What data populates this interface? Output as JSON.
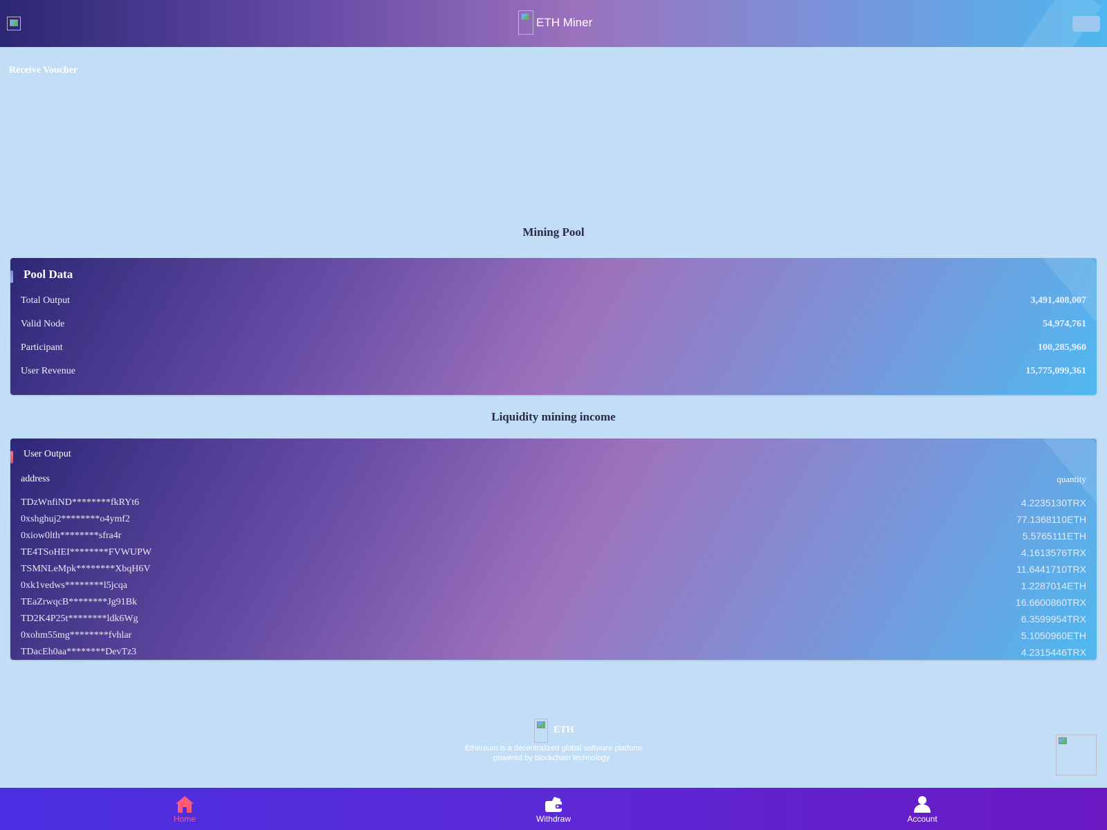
{
  "header": {
    "title": "ETH Miner"
  },
  "voucher_label": "Receive Voucher",
  "pool": {
    "section_title": "Mining Pool",
    "card_title": "Pool Data",
    "stats": [
      {
        "label": "Total Output",
        "value": "3,491,408,007"
      },
      {
        "label": "Valid Node",
        "value": "54,974,761"
      },
      {
        "label": "Participant",
        "value": "100,285,960"
      },
      {
        "label": "User Revenue",
        "value": "15,775,099,361"
      }
    ]
  },
  "liquidity": {
    "section_title": "Liquidity mining income",
    "card_title": "User Output",
    "col_address": "address",
    "col_quantity": "quantity",
    "rows": [
      {
        "address": "TDzWnfiND********fkRYt6",
        "quantity": "4.2235130TRX"
      },
      {
        "address": "0xshghuj2********o4ymf2",
        "quantity": "77.1368110ETH"
      },
      {
        "address": "0xiow0lth********sfra4r",
        "quantity": "5.5765111ETH"
      },
      {
        "address": "TE4TSoHEI********FVWUPW",
        "quantity": "4.1613576TRX"
      },
      {
        "address": "TSMNLeMpk********XbqH6V",
        "quantity": "11.6441710TRX"
      },
      {
        "address": "0xk1vedws********l5jcqa",
        "quantity": "1.2287014ETH"
      },
      {
        "address": "TEaZrwqcB********Jg91Bk",
        "quantity": "16.6600860TRX"
      },
      {
        "address": "TD2K4P25t********ldk6Wg",
        "quantity": "6.3599954TRX"
      },
      {
        "address": "0xohm55mg********fvhlar",
        "quantity": "5.1050960ETH"
      },
      {
        "address": "TDacEh0aa********DevTz3",
        "quantity": "4.2315446TRX"
      }
    ]
  },
  "footer": {
    "name": "ETH",
    "description": "Ethereum is a decentralized global software platform powered by blockchain technology ."
  },
  "tabs": [
    {
      "label": "Home",
      "icon": "home-icon",
      "active": true
    },
    {
      "label": "Withdraw",
      "icon": "wallet-icon",
      "active": false
    },
    {
      "label": "Account",
      "icon": "user-icon",
      "active": false
    }
  ],
  "colors": {
    "accent_active_tab": "#ff5a7a",
    "tabbar": "#5b29d6",
    "page_bg": "#c2ddf6"
  }
}
